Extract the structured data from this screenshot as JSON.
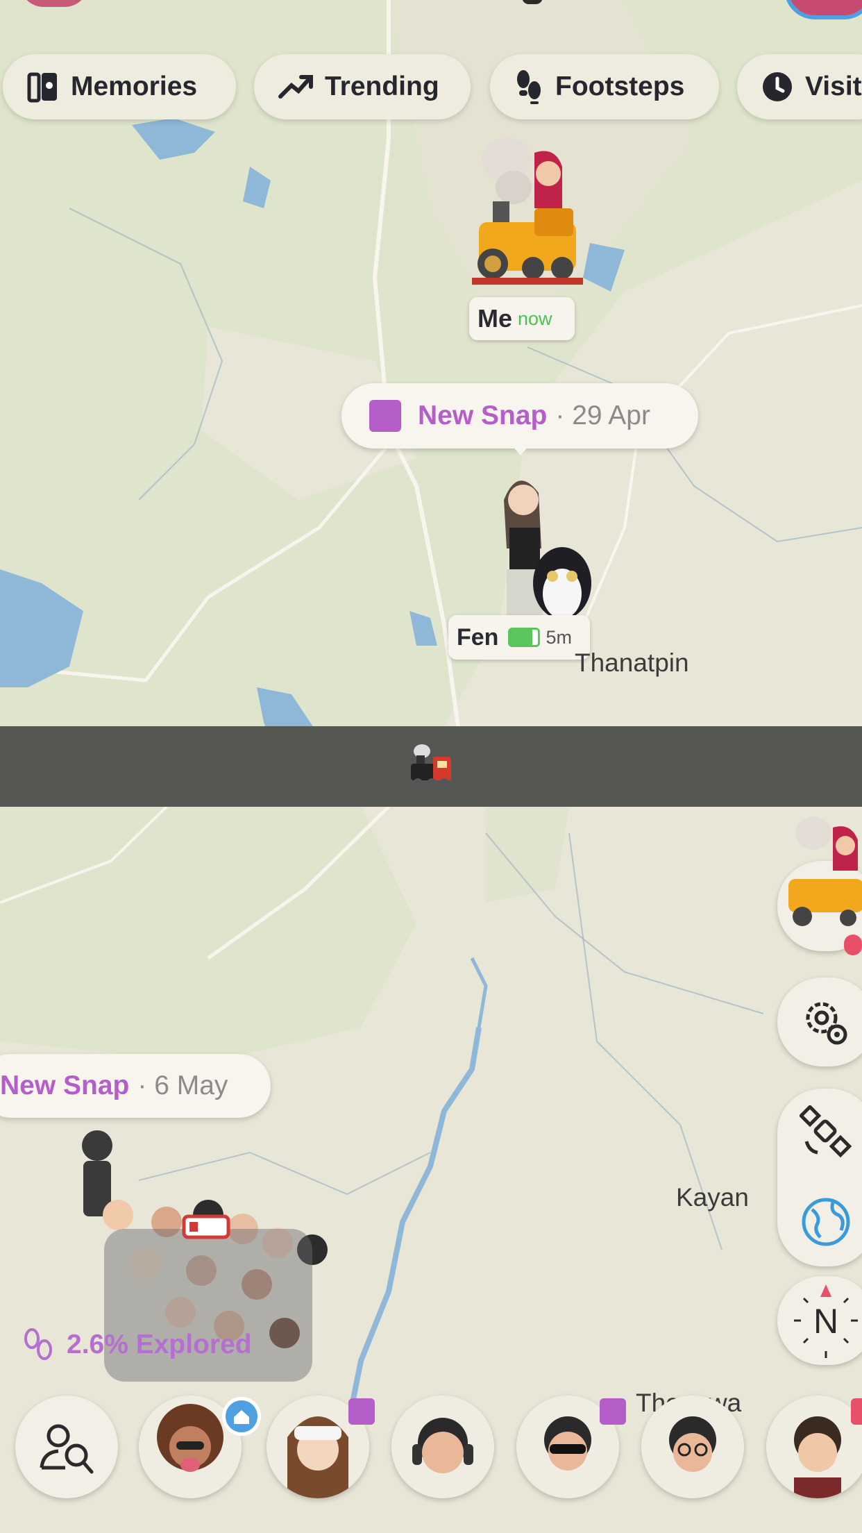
{
  "chips": [
    {
      "label": "Memories",
      "icon": "memories-icon"
    },
    {
      "label": "Trending",
      "icon": "trending-arrow-icon"
    },
    {
      "label": "Footsteps",
      "icon": "footsteps-icon"
    },
    {
      "label": "Visit",
      "icon": "clock-icon"
    }
  ],
  "me_label": {
    "name": "Me",
    "time": "now"
  },
  "snap1": {
    "title": "New Snap",
    "date": "· 29 Apr"
  },
  "fen_label": {
    "name": "Fen",
    "time": "5m"
  },
  "snap2": {
    "title": "New Snap",
    "date": "· 6 May"
  },
  "places": {
    "thanatpin": "Thanatpin",
    "kayan": "Kayan",
    "thongwa": "Thongwa"
  },
  "explored": {
    "text": "2.6% Explored"
  },
  "colors": {
    "accent_purple": "#b55ec9",
    "battery_green": "#5cc45c",
    "map_water": "#8fb8d8"
  }
}
